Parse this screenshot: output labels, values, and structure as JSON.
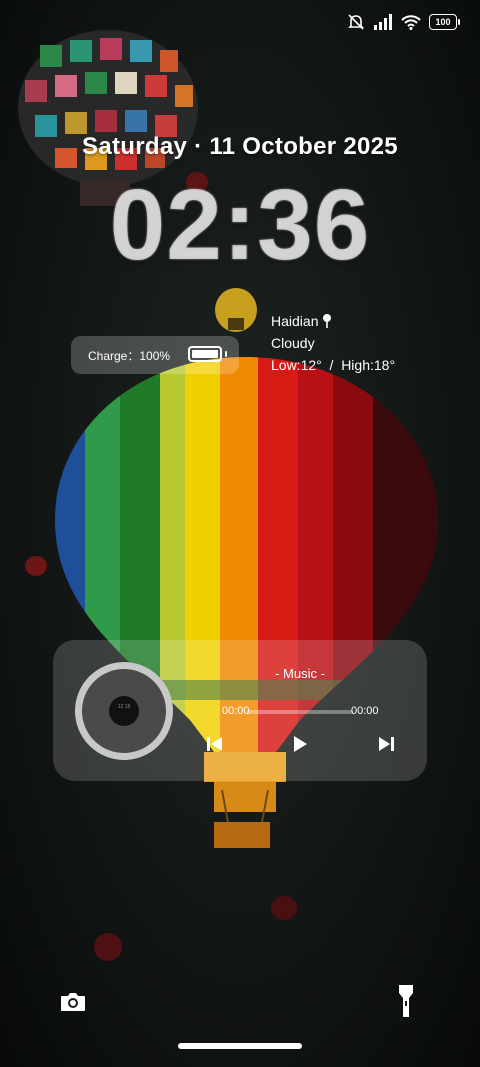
{
  "status_bar": {
    "icons": [
      "mute-icon",
      "signal-icon",
      "wifi-icon",
      "battery-icon"
    ],
    "battery_level": "100"
  },
  "lockscreen": {
    "date": "Saturday · 11 October 2025",
    "time": "02:36"
  },
  "charge_widget": {
    "label": "Charge：100%",
    "battery_fraction": 1.0
  },
  "weather": {
    "location": "Haidian",
    "condition": "Cloudy",
    "low_high": "Low:12°  /  High:18°"
  },
  "music_player": {
    "title": "- Music -",
    "elapsed": "00:00",
    "duration": "00:00",
    "progress_fraction": 0.0,
    "disc_label": "12 18"
  },
  "bottom_actions": {
    "left": "camera-icon",
    "right": "flashlight-icon"
  },
  "colors": {
    "card_background": "rgba(255,255,255,0.17)",
    "clock_text": "#e1e1e1"
  }
}
